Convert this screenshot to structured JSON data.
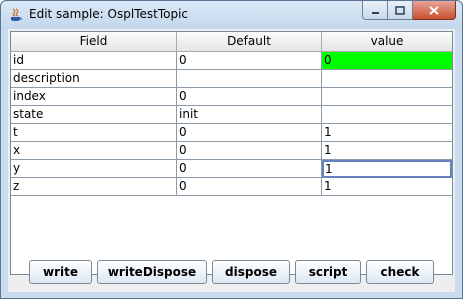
{
  "window": {
    "title": "Edit sample: OsplTestTopic",
    "icon": "java-icon"
  },
  "controls": {
    "minimize": "minimize-icon",
    "maximize": "maximize-icon",
    "close": "close-icon"
  },
  "table": {
    "headers": [
      "Field",
      "Default",
      "value"
    ],
    "rows": [
      {
        "field": "id",
        "default": "0",
        "value": "0",
        "highlight": "#00ff00"
      },
      {
        "field": "description",
        "default": "",
        "value": ""
      },
      {
        "field": "index",
        "default": "0",
        "value": ""
      },
      {
        "field": "state",
        "default": "init",
        "value": ""
      },
      {
        "field": "t",
        "default": "0",
        "value": "1"
      },
      {
        "field": "x",
        "default": "0",
        "value": "1"
      },
      {
        "field": "y",
        "default": "0",
        "value": "1",
        "focused": true
      },
      {
        "field": "z",
        "default": "0",
        "value": "1"
      }
    ]
  },
  "buttons": {
    "write": "write",
    "writeDispose": "writeDispose",
    "dispose": "dispose",
    "script": "script",
    "check": "check"
  },
  "colors": {
    "highlight": "#00ff00",
    "focus_border": "#6382bf",
    "frame": "#c9dcef"
  }
}
